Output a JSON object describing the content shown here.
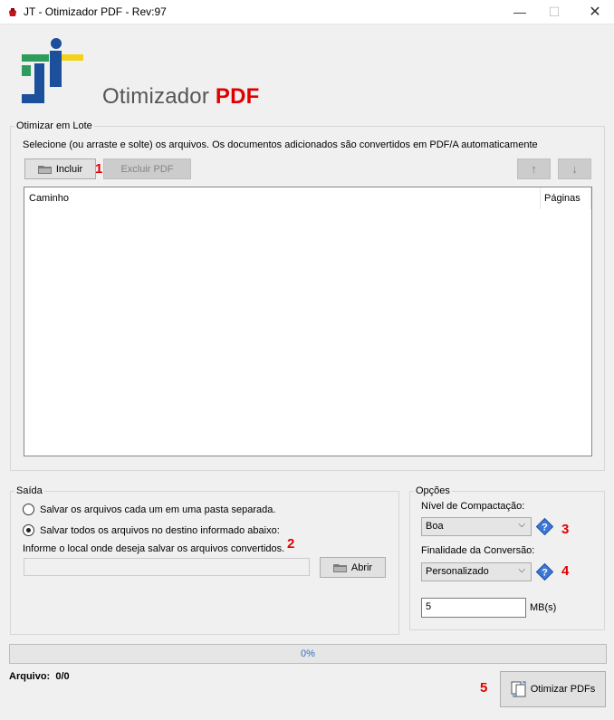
{
  "window": {
    "title": "JT - Otimizador PDF - Rev:97",
    "minimize_glyph": "—",
    "maximize_glyph": "☐",
    "close_glyph": "✕"
  },
  "header": {
    "title_main": "Otimizador",
    "title_accent": "PDF"
  },
  "batch": {
    "group_label": "Otimizar em Lote",
    "instructions": "Selecione (ou arraste e solte) os arquivos. Os documentos adicionados são convertidos em PDF/A automaticamente",
    "include_label": "Incluir",
    "remove_label": "Excluir PDF",
    "up_glyph": "↑",
    "down_glyph": "↓",
    "marker": "1",
    "columns": [
      "Caminho",
      "Páginas"
    ]
  },
  "output": {
    "group_label": "Saída",
    "option_separate": "Salvar os arquivos cada um em uma pasta separada.",
    "option_destination": "Salvar todos os arquivos no destino informado abaixo:",
    "selected": "destination",
    "destination_prompt": "Informe o local onde deseja salvar os arquivos convertidos.",
    "destination_value": "",
    "open_label": "Abrir",
    "marker": "2"
  },
  "options": {
    "group_label": "Opções",
    "compression_label": "Nível de Compactação:",
    "compression_value": "Boa",
    "compression_marker": "3",
    "purpose_label": "Finalidade da Conversão:",
    "purpose_value": "Personalizado",
    "purpose_marker": "4",
    "size_value": "5",
    "size_unit": "MB(s)",
    "help_glyph": "?",
    "chevron_glyph": "⌵"
  },
  "progress": {
    "percent": 0,
    "text": "0%"
  },
  "footer": {
    "file_label": "Arquivo:",
    "file_count": "0/0",
    "optimize_label": "Otimizar PDFs",
    "marker": "5"
  },
  "colors": {
    "accent_red": "#e00000",
    "logo_blue": "#1c4f9c",
    "logo_green": "#2e9d5b",
    "logo_yellow": "#f2d21b",
    "help_blue": "#3c78d8"
  }
}
